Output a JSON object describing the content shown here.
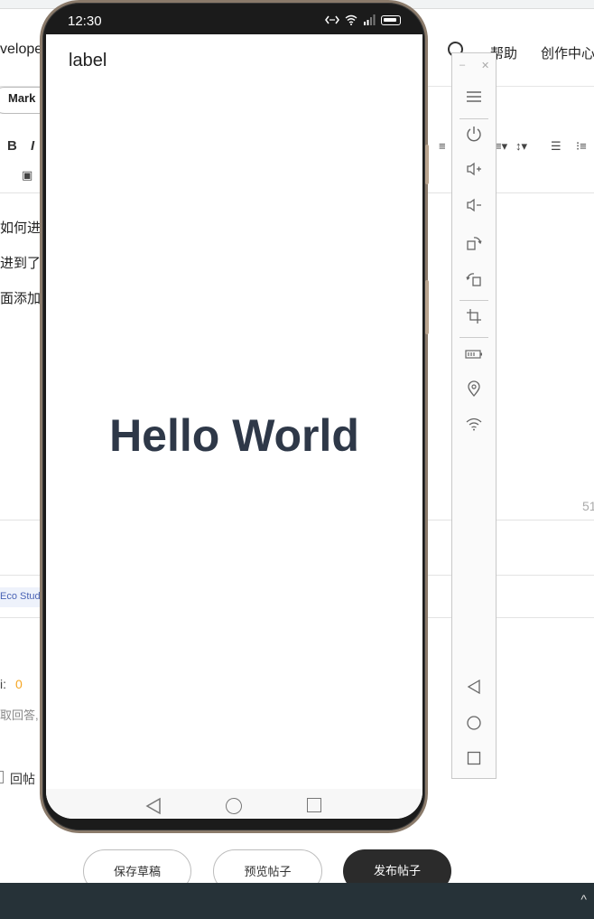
{
  "background_page": {
    "header": {
      "site_partial": "velope",
      "help_label": "帮助",
      "creator_center_label": "创作中心"
    },
    "editor_mode_pill": "Mark",
    "toolbar": {
      "bold": "B",
      "italic": "I"
    },
    "editor_lines": [
      "如何进",
      "进到了",
      "面添加"
    ],
    "char_count": "51",
    "tag": "Eco Stud",
    "reward": {
      "label_partial": "i:",
      "value": "0"
    },
    "hint_partial": "取回答,",
    "checkbox_label_partial": "回帖",
    "buttons": {
      "save_draft": "保存草稿",
      "preview": "预览帖子",
      "publish": "发布帖子"
    }
  },
  "phone": {
    "status_time": "12:30",
    "app_label": "label",
    "main_text": "Hello World",
    "nav": [
      "back-icon",
      "home-icon",
      "recents-icon"
    ]
  },
  "side_panel": {
    "icons": [
      "menu-icon",
      "power-icon",
      "volume-up-icon",
      "volume-down-icon",
      "rotate-right-icon",
      "rotate-left-icon",
      "crop-icon",
      "battery-icon",
      "location-icon",
      "wifi-icon",
      "back-icon",
      "home-icon",
      "recents-icon"
    ]
  },
  "colors": {
    "hello_text": "#2e3848",
    "publish_button": "#2b2b2b",
    "taskbar": "#263238",
    "reward_value": "#f5a623"
  }
}
